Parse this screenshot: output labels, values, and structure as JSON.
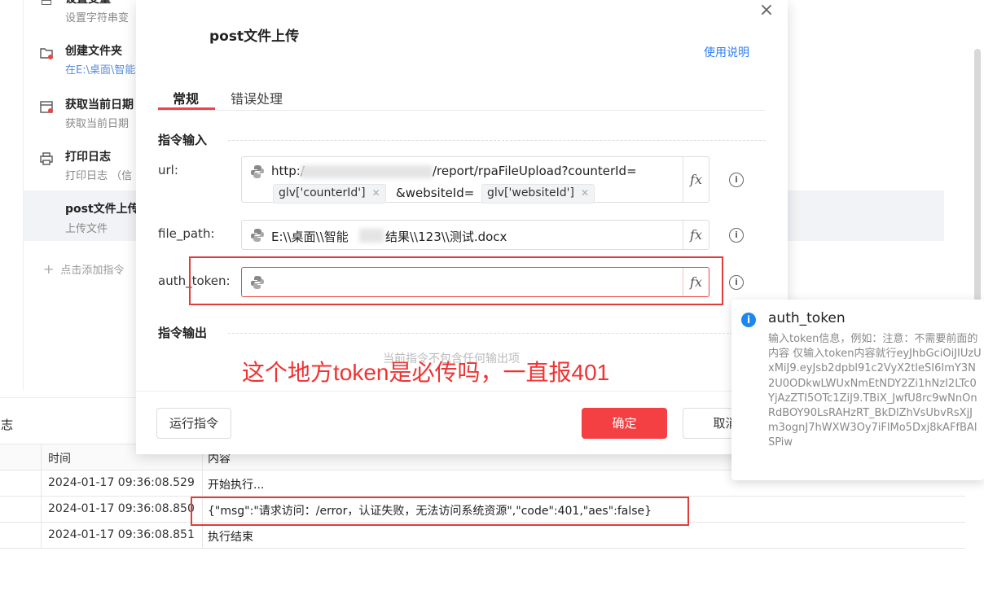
{
  "commands": [
    {
      "title": "设置变量",
      "desc": "设置字符串变",
      "icon": "variable-icon"
    },
    {
      "title": "创建文件夹",
      "desc": "在E:\\桌面\\智能",
      "icon": "folder-add-icon"
    },
    {
      "title": "获取当前日期",
      "desc": "获取当前日期",
      "icon": "calendar-icon"
    },
    {
      "title": "打印日志",
      "desc": "打印日志 （信",
      "icon": "printer-icon"
    },
    {
      "title": "post文件上传",
      "desc": "上传文件",
      "icon": "upload-icon"
    }
  ],
  "add_command": "点击添加指令",
  "log": {
    "title": "日志",
    "col_time": "时间",
    "col_content": "内容",
    "rows": [
      {
        "time": "2024-01-17 09:36:08.529",
        "msg": "开始执行..."
      },
      {
        "time": "2024-01-17 09:36:08.850",
        "msg": "{\"msg\":\"请求访问：/error，认证失败，无法访问系统资源\",\"code\":401,\"aes\":false}"
      },
      {
        "time": "2024-01-17 09:36:08.851",
        "msg": "执行结束"
      }
    ]
  },
  "modal": {
    "title": "post文件上传",
    "usage_link": "使用说明",
    "tabs": [
      "常规",
      "错误处理"
    ],
    "section_input": "指令输入",
    "section_output": "指令输出",
    "no_output": "当前指令不包含任何输出项",
    "fields": {
      "url": {
        "label": "url:",
        "part1": "http:/",
        "part2": "/report/rpaFileUpload?counterId=",
        "tag1": "glv['counterId']",
        "mid": "&websiteId=",
        "tag2": "glv['websiteId']"
      },
      "file_path": {
        "label": "file_path:",
        "value_a": "E:\\\\桌面\\\\智能",
        "value_b": "结果\\\\123\\\\测试.docx"
      },
      "auth_token": {
        "label": "auth_token:",
        "value": ""
      }
    },
    "fx": "fx",
    "run_button": "运行指令",
    "ok_button": "确定",
    "cancel_button": "取消"
  },
  "annotation": "这个地方token是必传吗，一直报401",
  "tooltip": {
    "title": "auth_token",
    "body": "输入token信息，例如：注意：不需要前面的内容 仅输入token内容就行eyJhbGciOiJIUzUxMiJ9.eyJsb2dpbl91c2VyX2tleSI6ImY3N2U0ODkwLWUxNmEtNDY2Zi1hNzI2LTc0YjAzZTI5OTc1ZiJ9.TBiX_JwfU8rc9wNnOnRdBOY90LsRAHzRT_BkDlZhVsUbvRsXjJm3ognJ7hWXW3Oy7iFlMo5Dxj8kAFfBAlSPiw"
  },
  "colors": {
    "accent": "#f43f43",
    "link": "#2f7df6",
    "annotation": "#f03232"
  }
}
